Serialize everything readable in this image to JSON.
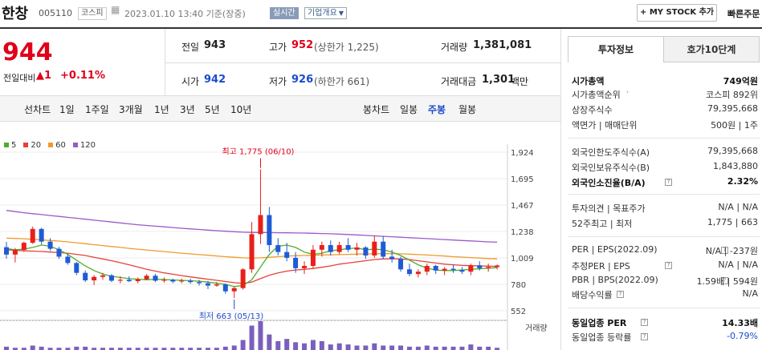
{
  "header": {
    "stock_name": "한창",
    "stock_code": "005110",
    "market": "코스피",
    "datetime": "2023.01.10 13:40 기준(장중)",
    "realtime_label": "실시간",
    "company_info_label": "기업개요",
    "mystock_label": "+ MY STOCK 추가",
    "quick_order_label": "빠른주문"
  },
  "quote": {
    "price": "944",
    "change_label": "전일대비",
    "change_value": "▲1",
    "change_pct": "+0.11%",
    "prev_close_label": "전일",
    "prev_close": "943",
    "high_label": "고가",
    "high": "952",
    "upper_limit": "(상한가 1,225)",
    "volume_label": "거래량",
    "volume": "1,381,081",
    "open_label": "시가",
    "open": "942",
    "low_label": "저가",
    "low": "926",
    "lower_limit": "(하한가 661)",
    "amount_label": "거래대금",
    "amount": "1,301",
    "amount_unit": "백만"
  },
  "period_tabs": {
    "line_label": "선차트",
    "line_items": [
      "1일",
      "1주일",
      "3개월",
      "1년",
      "3년",
      "5년",
      "10년"
    ],
    "candle_label": "봉차트",
    "candle_items": [
      "일봉",
      "주봉",
      "월봉"
    ],
    "active": "주봉"
  },
  "side_tabs": {
    "invest": "투자정보",
    "quote10": "호가10단계"
  },
  "invest_info": {
    "rows": [
      {
        "k": "시가총액",
        "v": "749억원",
        "bold": true
      },
      {
        "k": "시가총액순위",
        "v": "코스피 892위",
        "arrow": true
      },
      {
        "k": "상장주식수",
        "v": "79,395,668"
      },
      {
        "k": "액면가 | 매매단위",
        "v": "500원 | 1주"
      },
      {
        "k": "외국인한도주식수(A)",
        "v": "79,395,668"
      },
      {
        "k": "외국인보유주식수(B)",
        "v": "1,843,880"
      },
      {
        "k": "외국인소진율(B/A)",
        "v": "2.32%",
        "bold": true,
        "help": true
      },
      {
        "k": "투자의견 | 목표주가",
        "v": "N/A | N/A"
      },
      {
        "k": "52주최고 | 최저",
        "v": "1,775 | 663"
      },
      {
        "k": "PER | EPS(2022.09)",
        "v": "N/A | -237원",
        "help": true
      },
      {
        "k": "추정PER | EPS",
        "v": "N/A | N/A",
        "help": true
      },
      {
        "k": "PBR | BPS(2022.09)",
        "v": "1.59배 | 594원",
        "help": true
      },
      {
        "k": "배당수익률",
        "v": "N/A",
        "help": true
      },
      {
        "k": "동일업종 PER",
        "v": "14.33배",
        "bold": true,
        "help": true
      },
      {
        "k": "동일업종 등락률",
        "v": "-0.79%",
        "help": true,
        "vcolor": "#1a4bcc"
      }
    ]
  },
  "chart_data": {
    "type": "candlestick",
    "period": "weekly",
    "legend": [
      {
        "name": "5",
        "color": "#4caf2c"
      },
      {
        "name": "20",
        "color": "#e8403b"
      },
      {
        "name": "60",
        "color": "#f19a2a"
      },
      {
        "name": "120",
        "color": "#9b59c9"
      }
    ],
    "y_ticks": [
      "1,924",
      "1,695",
      "1,467",
      "1,238",
      "1,009",
      "780",
      "552"
    ],
    "ylim": [
      552,
      1924
    ],
    "high_annotation": "최고 1,775 (06/10)",
    "low_annotation": "최저 663 (05/13)",
    "volume_label": "거래량",
    "candles": [
      [
        1102,
        1148,
        1002,
        1038
      ],
      [
        1038,
        1095,
        970,
        1078
      ],
      [
        1078,
        1150,
        1062,
        1140
      ],
      [
        1140,
        1280,
        1130,
        1260
      ],
      [
        1260,
        1270,
        1125,
        1150
      ],
      [
        1150,
        1180,
        1070,
        1088
      ],
      [
        1088,
        1105,
        1000,
        1020
      ],
      [
        1020,
        1040,
        950,
        965
      ],
      [
        965,
        975,
        860,
        880
      ],
      [
        880,
        900,
        800,
        815
      ],
      [
        815,
        860,
        775,
        845
      ],
      [
        845,
        880,
        820,
        858
      ],
      [
        858,
        870,
        800,
        812
      ],
      [
        812,
        850,
        790,
        820
      ],
      [
        820,
        850,
        800,
        808
      ],
      [
        808,
        840,
        790,
        825
      ],
      [
        825,
        870,
        815,
        855
      ],
      [
        855,
        870,
        800,
        812
      ],
      [
        812,
        840,
        795,
        820
      ],
      [
        820,
        830,
        790,
        805
      ],
      [
        805,
        830,
        790,
        812
      ],
      [
        812,
        830,
        785,
        800
      ],
      [
        800,
        820,
        770,
        790
      ],
      [
        790,
        810,
        740,
        770
      ],
      [
        770,
        800,
        760,
        780
      ],
      [
        780,
        790,
        700,
        720
      ],
      [
        720,
        760,
        663,
        748
      ],
      [
        748,
        920,
        735,
        910
      ],
      [
        910,
        1320,
        880,
        1215
      ],
      [
        1215,
        1775,
        1130,
        1380
      ],
      [
        1380,
        1450,
        1060,
        1120
      ],
      [
        1120,
        1180,
        1030,
        1060
      ],
      [
        1060,
        1140,
        980,
        1010
      ],
      [
        1010,
        1060,
        880,
        920
      ],
      [
        920,
        980,
        870,
        940
      ],
      [
        940,
        1120,
        920,
        1080
      ],
      [
        1080,
        1150,
        1020,
        1120
      ],
      [
        1120,
        1160,
        1030,
        1060
      ],
      [
        1060,
        1150,
        1040,
        1120
      ],
      [
        1120,
        1180,
        1060,
        1080
      ],
      [
        1080,
        1140,
        1030,
        1100
      ],
      [
        1100,
        1110,
        1000,
        1030
      ],
      [
        1030,
        1200,
        1010,
        1150
      ],
      [
        1150,
        1200,
        1000,
        1020
      ],
      [
        1020,
        1080,
        970,
        1000
      ],
      [
        1000,
        1020,
        890,
        910
      ],
      [
        910,
        960,
        850,
        870
      ],
      [
        870,
        910,
        840,
        890
      ],
      [
        890,
        960,
        860,
        940
      ],
      [
        940,
        950,
        870,
        900
      ],
      [
        900,
        930,
        860,
        915
      ],
      [
        915,
        950,
        880,
        905
      ],
      [
        905,
        930,
        870,
        890
      ],
      [
        890,
        960,
        860,
        945
      ],
      [
        945,
        980,
        900,
        920
      ],
      [
        920,
        960,
        890,
        930
      ],
      [
        930,
        952,
        910,
        944
      ]
    ],
    "ma5": [
      1090,
      1080,
      1085,
      1100,
      1120,
      1110,
      1080,
      1040,
      990,
      940,
      900,
      870,
      850,
      840,
      830,
      825,
      820,
      825,
      822,
      818,
      815,
      812,
      808,
      800,
      790,
      780,
      762,
      770,
      820,
      930,
      1040,
      1110,
      1120,
      1100,
      1060,
      1040,
      1050,
      1070,
      1080,
      1090,
      1095,
      1080,
      1085,
      1080,
      1060,
      1030,
      990,
      950,
      920,
      905,
      900,
      900,
      905,
      910,
      915,
      920,
      925
    ],
    "ma20": [
      1080,
      1075,
      1070,
      1068,
      1065,
      1060,
      1055,
      1050,
      1040,
      1030,
      1015,
      1000,
      985,
      968,
      950,
      930,
      910,
      895,
      880,
      868,
      856,
      845,
      835,
      825,
      815,
      805,
      795,
      788,
      800,
      830,
      860,
      880,
      895,
      905,
      910,
      918,
      928,
      940,
      955,
      965,
      975,
      985,
      995,
      1000,
      1002,
      1000,
      995,
      985,
      975,
      965,
      955,
      950,
      945,
      942,
      940,
      938,
      936
    ],
    "ma60": [
      1180,
      1178,
      1175,
      1170,
      1165,
      1160,
      1155,
      1148,
      1140,
      1132,
      1124,
      1116,
      1108,
      1100,
      1092,
      1085,
      1078,
      1071,
      1064,
      1057,
      1050,
      1044,
      1038,
      1032,
      1026,
      1020,
      1015,
      1010,
      1008,
      1010,
      1015,
      1020,
      1025,
      1028,
      1030,
      1032,
      1034,
      1036,
      1038,
      1040,
      1042,
      1044,
      1045,
      1046,
      1046,
      1045,
      1042,
      1038,
      1034,
      1030,
      1025,
      1020,
      1016,
      1012,
      1008,
      1004,
      1000
    ],
    "ma120": [
      1420,
      1410,
      1400,
      1392,
      1384,
      1376,
      1368,
      1360,
      1352,
      1344,
      1336,
      1328,
      1320,
      1312,
      1304,
      1296,
      1290,
      1284,
      1278,
      1272,
      1266,
      1260,
      1255,
      1250,
      1245,
      1240,
      1236,
      1232,
      1230,
      1229,
      1228,
      1227,
      1226,
      1225,
      1224,
      1222,
      1220,
      1218,
      1215,
      1212,
      1208,
      1204,
      1200,
      1196,
      1192,
      1188,
      1184,
      1180,
      1176,
      1172,
      1168,
      1164,
      1160,
      1156,
      1152,
      1148,
      1145
    ],
    "volume": [
      3,
      2,
      2,
      4,
      3,
      2,
      2,
      2,
      3,
      3,
      2,
      2,
      2,
      2,
      2,
      2,
      2,
      2,
      2,
      2,
      2,
      2,
      2,
      2,
      2,
      3,
      4,
      9,
      22,
      26,
      14,
      8,
      10,
      7,
      6,
      9,
      8,
      5,
      6,
      5,
      4,
      4,
      6,
      4,
      4,
      4,
      3,
      3,
      4,
      3,
      3,
      3,
      3,
      5,
      3,
      3,
      2
    ]
  }
}
